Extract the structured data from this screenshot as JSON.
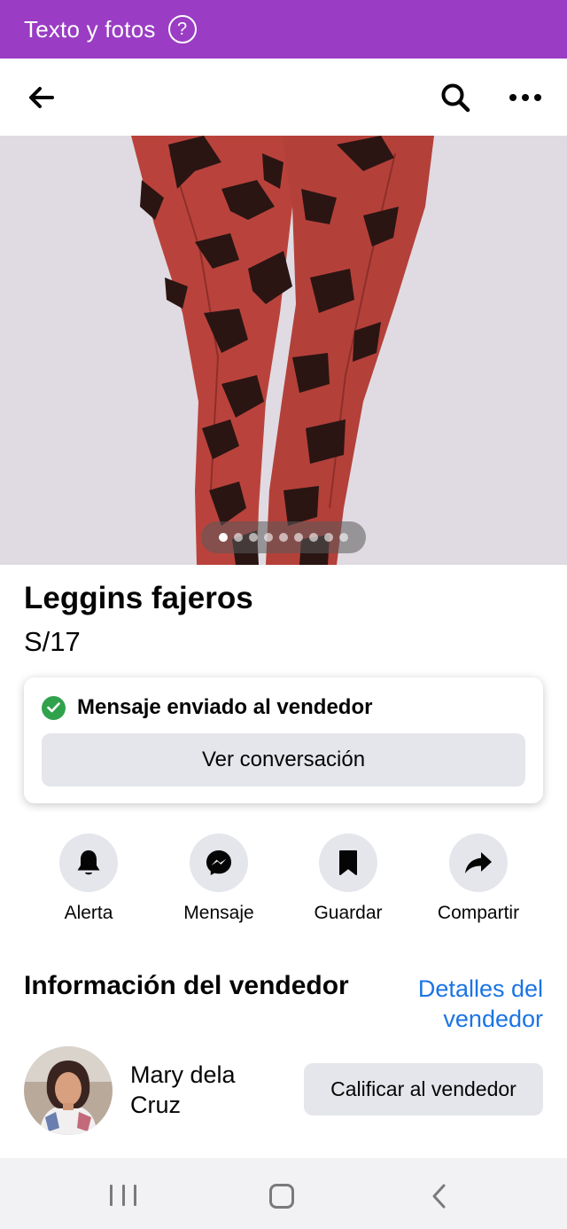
{
  "banner": {
    "text": "Texto y fotos",
    "help_glyph": "?",
    "color": "#9a3cc4"
  },
  "nav": {
    "back_icon": "arrow-left-icon",
    "search_icon": "search-icon",
    "more_icon": "more-horizontal-icon"
  },
  "photo": {
    "dot_count": 9,
    "active_dot": 1
  },
  "listing": {
    "title": "Leggins fajeros",
    "price": "S/17"
  },
  "message_card": {
    "status": "Mensaje enviado al vendedor",
    "button": "Ver conversación"
  },
  "actions": [
    {
      "label": "Alerta",
      "icon": "bell-icon"
    },
    {
      "label": "Mensaje",
      "icon": "messenger-icon"
    },
    {
      "label": "Guardar",
      "icon": "bookmark-icon"
    },
    {
      "label": "Compartir",
      "icon": "share-icon"
    }
  ],
  "seller": {
    "heading": "Información del vendedor",
    "details_link": "Detalles del vendedor",
    "name": "Mary dela Cruz",
    "rate_button": "Calificar al vendedor"
  },
  "colors": {
    "accent_link": "#1b74e4",
    "success": "#31a24c",
    "button_bg": "#e4e6eb"
  }
}
